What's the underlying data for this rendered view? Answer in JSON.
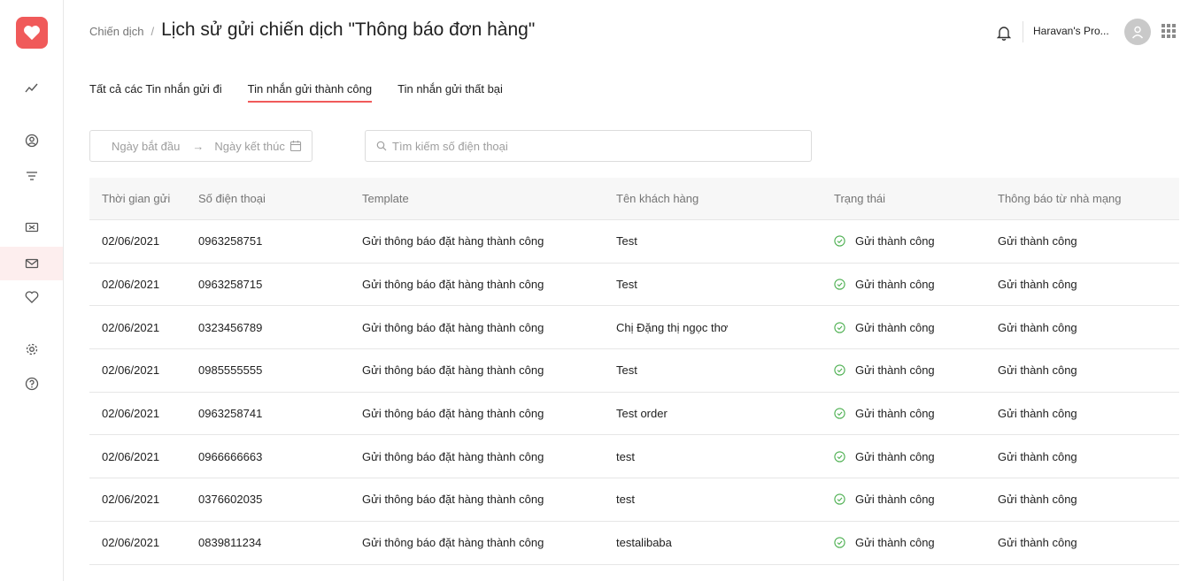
{
  "sidebar": {
    "items": [
      {
        "icon": "trend-icon",
        "active": false
      },
      {
        "icon": "user-circle-icon",
        "active": false
      },
      {
        "icon": "filter-icon",
        "active": false
      },
      {
        "icon": "ticket-icon",
        "active": false
      },
      {
        "icon": "mail-icon",
        "active": true
      },
      {
        "icon": "heart-icon",
        "active": false
      },
      {
        "icon": "gear-icon",
        "active": false
      },
      {
        "icon": "help-icon",
        "active": false
      }
    ]
  },
  "header": {
    "breadcrumb_parent": "Chiến dịch",
    "breadcrumb_sep": "/",
    "title": "Lịch sử gửi chiến dịch \"Thông báo đơn hàng\"",
    "store_name": "Haravan's Pro..."
  },
  "tabs": [
    {
      "label": "Tất cả các Tin nhắn gửi đi",
      "active": false
    },
    {
      "label": "Tin nhắn gửi thành công",
      "active": true
    },
    {
      "label": "Tin nhắn gửi thất bại",
      "active": false
    }
  ],
  "filters": {
    "date_start_placeholder": "Ngày bắt đầu",
    "date_sep": "→",
    "date_end_placeholder": "Ngày kết thúc",
    "search_placeholder": "Tìm kiếm số điện thoại"
  },
  "table": {
    "headers": [
      "Thời gian gửi",
      "Số điện thoại",
      "Template",
      "Tên khách hàng",
      "Trạng thái",
      "Thông báo từ nhà mạng"
    ],
    "rows": [
      [
        "02/06/2021",
        "0963258751",
        "Gửi thông báo đặt hàng thành công",
        "Test",
        "Gửi thành công",
        "Gửi thành công"
      ],
      [
        "02/06/2021",
        "0963258715",
        "Gửi thông báo đặt hàng thành công",
        "Test",
        "Gửi thành công",
        "Gửi thành công"
      ],
      [
        "02/06/2021",
        "0323456789",
        "Gửi thông báo đặt hàng thành công",
        "Chị Đặng thị ngọc thơ",
        "Gửi thành công",
        "Gửi thành công"
      ],
      [
        "02/06/2021",
        "0985555555",
        "Gửi thông báo đặt hàng thành công",
        "Test",
        "Gửi thành công",
        "Gửi thành công"
      ],
      [
        "02/06/2021",
        "0963258741",
        "Gửi thông báo đặt hàng thành công",
        "Test order",
        "Gửi thành công",
        "Gửi thành công"
      ],
      [
        "02/06/2021",
        "0966666663",
        "Gửi thông báo đặt hàng thành công",
        "test",
        "Gửi thành công",
        "Gửi thành công"
      ],
      [
        "02/06/2021",
        "0376602035",
        "Gửi thông báo đặt hàng thành công",
        "test",
        "Gửi thành công",
        "Gửi thành công"
      ],
      [
        "02/06/2021",
        "0839811234",
        "Gửi thông báo đặt hàng thành công",
        "testalibaba",
        "Gửi thành công",
        "Gửi thành công"
      ]
    ]
  },
  "colors": {
    "accent": "#f05a5a",
    "success": "#4caf50"
  }
}
